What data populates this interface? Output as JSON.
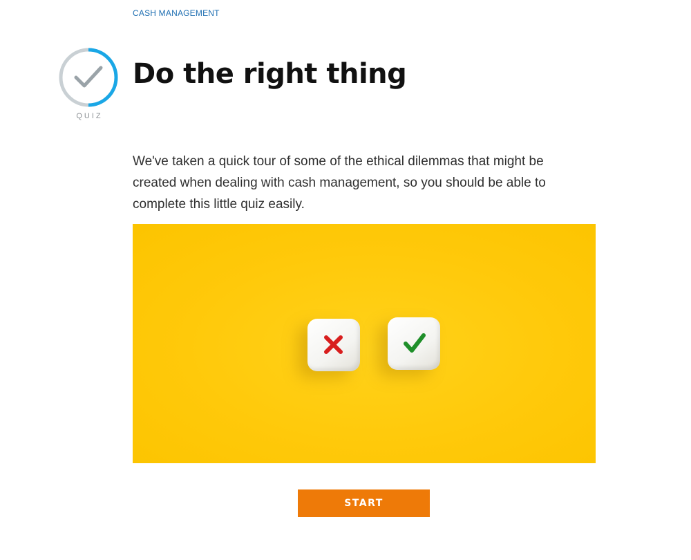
{
  "breadcrumb": "CASH MANAGEMENT",
  "badge": {
    "icon": "check-circle-icon",
    "label": "QUIZ",
    "ring_color": "#c9d0d4",
    "progress_color": "#1aa7e6",
    "check_color": "#9aa3a8"
  },
  "title": "Do the right thing",
  "intro": "We've taken a quick tour of some of the ethical dilemmas that might be created when dealing with cash management, so you should be able to complete this little quiz easily.",
  "hero": {
    "background_color": "#ffc90a",
    "dice": [
      {
        "icon": "cross-icon",
        "symbol_color": "#d81e1e"
      },
      {
        "icon": "check-icon",
        "symbol_color": "#1f8f2a"
      }
    ]
  },
  "start_button": {
    "label": "START",
    "color": "#ee7a08"
  }
}
